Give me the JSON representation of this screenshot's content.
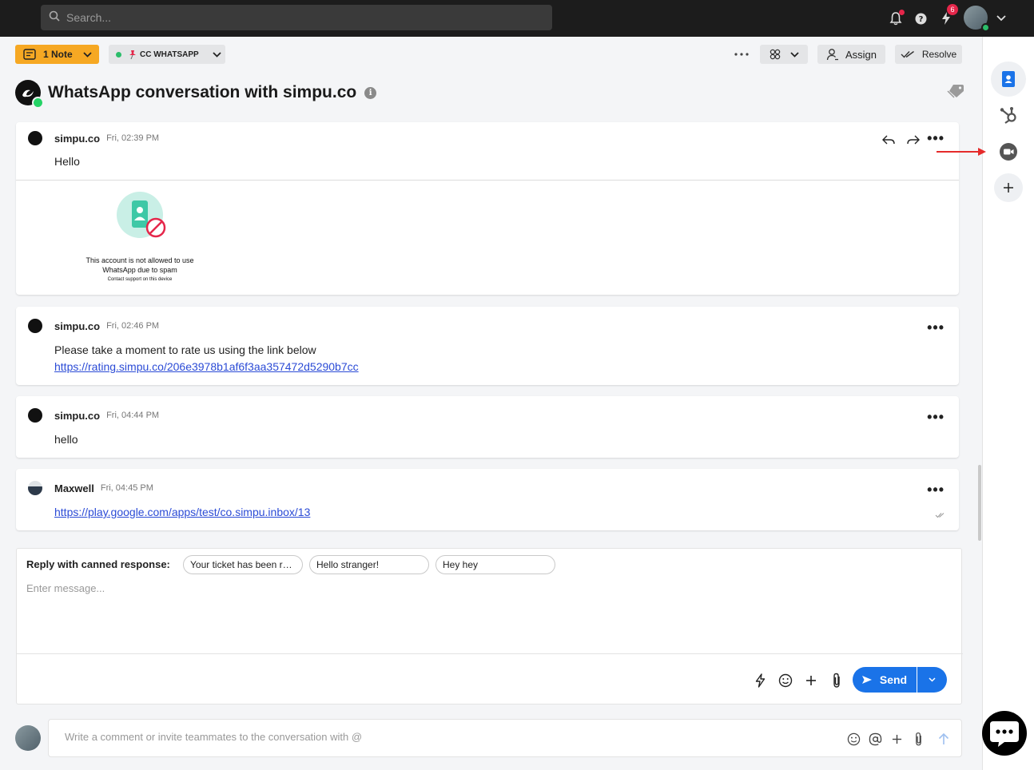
{
  "topbar": {
    "search_placeholder": "Search...",
    "notification_count": "6"
  },
  "toolbar": {
    "note_label": "1 Note",
    "channel_label": "CC WHATSAPP",
    "assign_label": "Assign",
    "resolve_label": "Resolve"
  },
  "conversation": {
    "title": "WhatsApp conversation with simpu.co"
  },
  "messages": [
    {
      "sender": "simpu.co",
      "time": "Fri, 02:39 PM",
      "text": "Hello",
      "image_caption_1": "This account is not allowed to use",
      "image_caption_2": "WhatsApp due to spam",
      "image_caption_3": "Contact support on this device"
    },
    {
      "sender": "simpu.co",
      "time": "Fri, 02:46 PM",
      "text": "Please take a moment to rate us using the link below",
      "link": "https://rating.simpu.co/206e3978b1af6f3aa357472d5290b7cc"
    },
    {
      "sender": "simpu.co",
      "time": "Fri, 04:44 PM",
      "text": "hello"
    },
    {
      "sender": "Maxwell",
      "time": "Fri, 04:45 PM",
      "link": "https://play.google.com/apps/test/co.simpu.inbox/13"
    }
  ],
  "composer": {
    "canned_label": "Reply with canned response:",
    "canned": [
      "Your ticket has been r…",
      "Hello stranger!",
      "Hey hey"
    ],
    "placeholder": "Enter message...",
    "send_label": "Send"
  },
  "comment": {
    "placeholder": "Write a comment or invite teammates to the conversation with @"
  },
  "colors": {
    "accent": "#1a73e8",
    "note": "#f6a823",
    "whatsapp": "#25d366",
    "alert": "#e5264a"
  }
}
